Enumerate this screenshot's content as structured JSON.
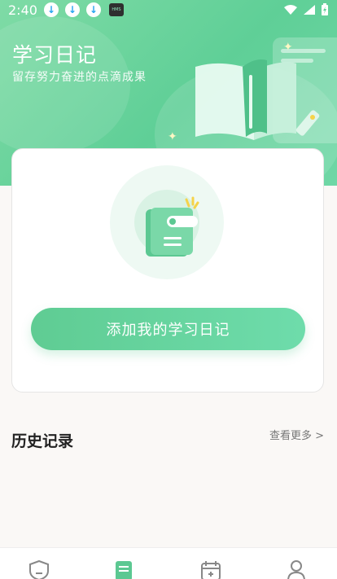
{
  "status_bar": {
    "time": "2:40",
    "notification_icons": [
      "download-icon",
      "download-icon",
      "download-icon",
      "hms-app-icon"
    ],
    "hms_label": "HMS",
    "right_icons": [
      "wifi-icon",
      "signal-icon",
      "battery-charging-icon"
    ]
  },
  "header": {
    "title": "学习日记",
    "subtitle": "留存努力奋进的点滴成果"
  },
  "card": {
    "add_button_label": "添加我的学习日记"
  },
  "history": {
    "title": "历史记录",
    "more_label": "查看更多 >"
  },
  "tabbar": {
    "active_index": 1,
    "tabs": [
      {
        "icon": "shield-icon"
      },
      {
        "icon": "notebook-icon"
      },
      {
        "icon": "calendar-add-icon"
      },
      {
        "icon": "user-icon"
      }
    ]
  },
  "colors": {
    "primary_green": "#5fcf97",
    "accent_yellow": "#f5d34a",
    "background": "#faf8f6"
  }
}
